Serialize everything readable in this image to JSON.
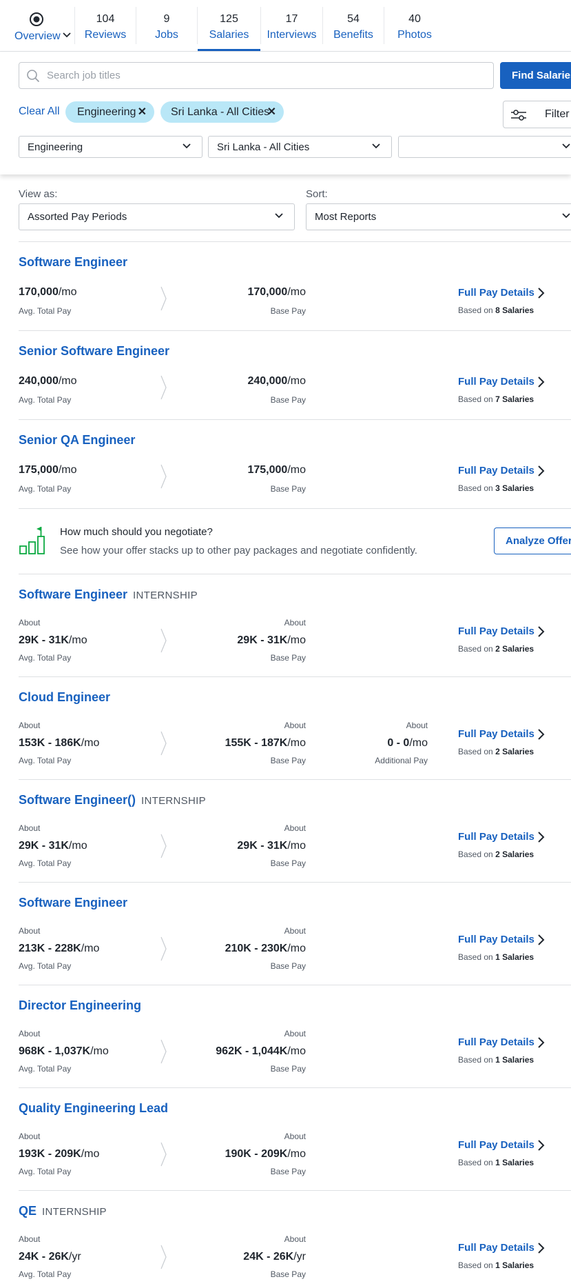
{
  "tabs": {
    "overview": "Overview",
    "items": [
      {
        "count": "104",
        "label": "Reviews"
      },
      {
        "count": "9",
        "label": "Jobs"
      },
      {
        "count": "125",
        "label": "Salaries"
      },
      {
        "count": "17",
        "label": "Interviews"
      },
      {
        "count": "54",
        "label": "Benefits"
      },
      {
        "count": "40",
        "label": "Photos"
      }
    ],
    "active": "Salaries"
  },
  "search": {
    "placeholder": "Search job titles",
    "button": "Find Salaries",
    "clear_all": "Clear All",
    "chips": [
      "Engineering",
      "Sri Lanka - All Cities"
    ],
    "filter_button": "Filter",
    "selects": [
      "Engineering",
      "Sri Lanka - All Cities",
      ""
    ]
  },
  "view": {
    "view_as_label": "View as:",
    "view_as_value": "Assorted Pay Periods",
    "sort_label": "Sort:",
    "sort_value": "Most Reports"
  },
  "labels": {
    "avg_total_pay": "Avg. Total Pay",
    "base_pay": "Base Pay",
    "additional_pay": "Additional Pay",
    "about": "About",
    "full_pay_details": "Full Pay Details",
    "based_on": "Based on"
  },
  "negotiate": {
    "title": "How much should you negotiate?",
    "subtitle": "See how your offer stacks up to other pay packages and negotiate confidently.",
    "button": "Analyze Offer"
  },
  "salaries": [
    {
      "title": "Software Engineer",
      "tag": "",
      "total": "170,000",
      "total_unit": "/mo",
      "base": "170,000",
      "base_unit": "/mo",
      "about": false,
      "additional": "",
      "reports": "8 Salaries"
    },
    {
      "title": "Senior Software Engineer",
      "tag": "",
      "total": "240,000",
      "total_unit": "/mo",
      "base": "240,000",
      "base_unit": "/mo",
      "about": false,
      "additional": "",
      "reports": "7 Salaries"
    },
    {
      "title": "Senior QA Engineer",
      "tag": "",
      "total": "175,000",
      "total_unit": "/mo",
      "base": "175,000",
      "base_unit": "/mo",
      "about": false,
      "additional": "",
      "reports": "3 Salaries"
    },
    {
      "title": "Software Engineer",
      "tag": "INTERNSHIP",
      "total": "29K - 31K",
      "total_unit": "/mo",
      "base": "29K - 31K",
      "base_unit": "/mo",
      "about": true,
      "additional": "",
      "reports": "2 Salaries"
    },
    {
      "title": "Cloud Engineer",
      "tag": "",
      "total": "153K - 186K",
      "total_unit": "/mo",
      "base": "155K - 187K",
      "base_unit": "/mo",
      "about": true,
      "additional": "0 - 0",
      "additional_unit": "/mo",
      "reports": "2 Salaries"
    },
    {
      "title": "Software Engineer()",
      "tag": "INTERNSHIP",
      "total": "29K - 31K",
      "total_unit": "/mo",
      "base": "29K - 31K",
      "base_unit": "/mo",
      "about": true,
      "additional": "",
      "reports": "2 Salaries"
    },
    {
      "title": "Software Engineer",
      "tag": "",
      "total": "213K - 228K",
      "total_unit": "/mo",
      "base": "210K - 230K",
      "base_unit": "/mo",
      "about": true,
      "additional": "",
      "reports": "1 Salaries"
    },
    {
      "title": "Director Engineering",
      "tag": "",
      "total": "968K - 1,037K",
      "total_unit": "/mo",
      "base": "962K - 1,044K",
      "base_unit": "/mo",
      "about": true,
      "additional": "",
      "reports": "1 Salaries"
    },
    {
      "title": "Quality Engineering Lead",
      "tag": "",
      "total": "193K - 209K",
      "total_unit": "/mo",
      "base": "190K - 209K",
      "base_unit": "/mo",
      "about": true,
      "additional": "",
      "reports": "1 Salaries"
    },
    {
      "title": "QE",
      "tag": "INTERNSHIP",
      "total": "24K - 26K",
      "total_unit": "/yr",
      "base": "24K - 26K",
      "base_unit": "/yr",
      "about": true,
      "additional": "",
      "reports": "1 Salaries"
    }
  ]
}
